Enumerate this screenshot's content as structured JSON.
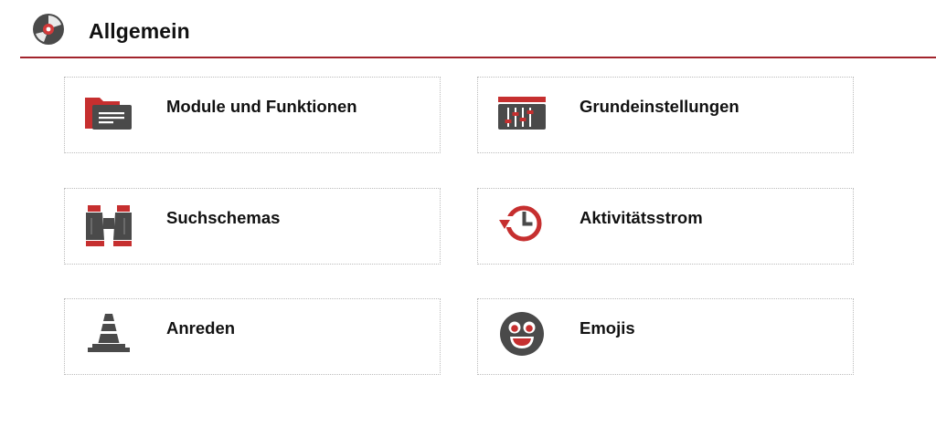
{
  "header": {
    "title": "Allgemein",
    "icon": "disc-icon"
  },
  "colors": {
    "accent_red": "#c62f2f",
    "rule_red": "#a2242c",
    "icon_gray": "#4a4a4a"
  },
  "cards": [
    {
      "label": "Module und Funktionen",
      "icon": "folder-icon"
    },
    {
      "label": "Grundeinstellungen",
      "icon": "sliders-icon"
    },
    {
      "label": "Suchschemas",
      "icon": "binoculars-icon"
    },
    {
      "label": "Aktivitätsstrom",
      "icon": "history-clock-icon"
    },
    {
      "label": "Anreden",
      "icon": "traffic-cone-icon"
    },
    {
      "label": "Emojis",
      "icon": "emoji-icon"
    }
  ]
}
